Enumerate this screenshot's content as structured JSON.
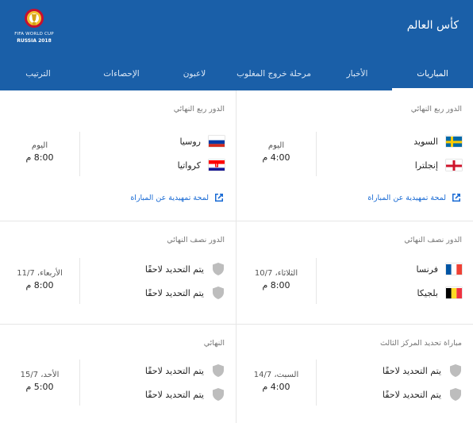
{
  "app": {
    "title": "كأس العالم"
  },
  "logo": {
    "line1": "FIFA WORLD CUP",
    "line2": "RUSSIA 2018"
  },
  "tabs": [
    {
      "label": "المباريات",
      "active": true
    },
    {
      "label": "الأخبار",
      "active": false
    },
    {
      "label": "مرحلة خروج المغلوب",
      "active": false
    },
    {
      "label": "لاعبون",
      "active": false
    },
    {
      "label": "الإحصاءات",
      "active": false
    },
    {
      "label": "الترتيب",
      "active": false
    }
  ],
  "colors": {
    "header": "#1a5fa8",
    "link": "#1a6bd4",
    "muted": "#757575"
  },
  "matches": [
    {
      "stage": "الدور ربع النهائي",
      "teams": [
        {
          "name": "السويد",
          "icon": "flag-sweden"
        },
        {
          "name": "إنجلترا",
          "icon": "flag-england"
        }
      ],
      "date": "اليوم",
      "time": "4:00 م",
      "preview": "لمحة تمهيدية عن المباراة"
    },
    {
      "stage": "الدور ربع النهائي",
      "teams": [
        {
          "name": "روسيا",
          "icon": "flag-russia"
        },
        {
          "name": "كرواتيا",
          "icon": "flag-croatia"
        }
      ],
      "date": "اليوم",
      "time": "8:00 م",
      "preview": "لمحة تمهيدية عن المباراة"
    },
    {
      "stage": "الدور نصف النهائي",
      "teams": [
        {
          "name": "فرنسا",
          "icon": "flag-france"
        },
        {
          "name": "بلجيكا",
          "icon": "flag-belgium"
        }
      ],
      "date": "الثلاثاء، 10/7",
      "time": "8:00 م"
    },
    {
      "stage": "الدور نصف النهائي",
      "teams": [
        {
          "name": "يتم التحديد لاحقًا",
          "icon": "shield-icon"
        },
        {
          "name": "يتم التحديد لاحقًا",
          "icon": "shield-icon"
        }
      ],
      "date": "الأربعاء، 11/7",
      "time": "8:00 م"
    },
    {
      "stage": "مباراة تحديد المركز الثالث",
      "teams": [
        {
          "name": "يتم التحديد لاحقًا",
          "icon": "shield-icon"
        },
        {
          "name": "يتم التحديد لاحقًا",
          "icon": "shield-icon"
        }
      ],
      "date": "السبت، 14/7",
      "time": "4:00 م"
    },
    {
      "stage": "النهائي",
      "teams": [
        {
          "name": "يتم التحديد لاحقًا",
          "icon": "shield-icon"
        },
        {
          "name": "يتم التحديد لاحقًا",
          "icon": "shield-icon"
        }
      ],
      "date": "الأحد، 15/7",
      "time": "5:00 م"
    }
  ]
}
